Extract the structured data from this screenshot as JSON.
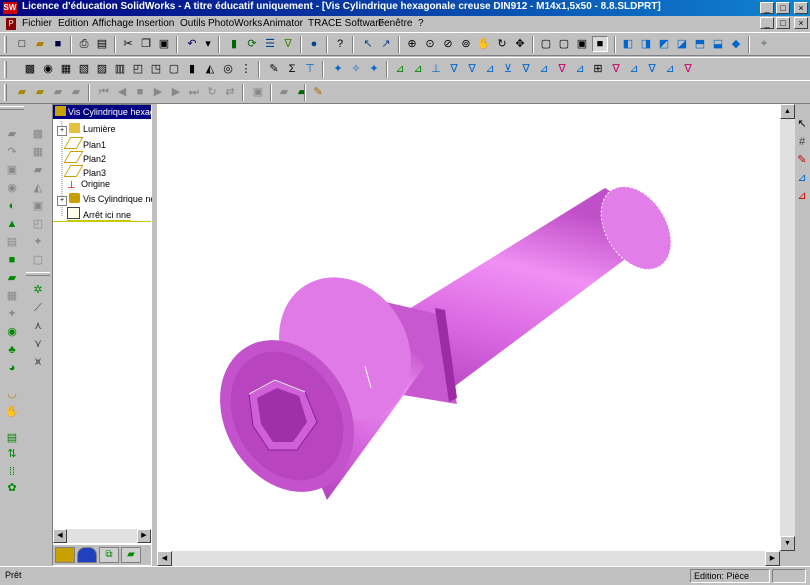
{
  "window": {
    "app_icon_text": "SW",
    "title": "Licence d'éducation SolidWorks - A titre éducatif uniquement - [Vis Cylindrique hexagonale creuse DIN912 - M14x1,5x50 - 8.8.SLDPRT]",
    "min": "_",
    "max": "□",
    "close": "×"
  },
  "menu": [
    "Fichier",
    "Edition",
    "Affichage",
    "Insertion",
    "Outils",
    "PhotoWorks",
    "Animator",
    "TRACE Software",
    "Fenêtre",
    "?"
  ],
  "feature_tree": {
    "root": "Vis Cylindrique hexagonale",
    "items": [
      "Lumière",
      "Plan1",
      "Plan2",
      "Plan3",
      "Origine",
      "Vis Cylindrique ne",
      "Arrêt ici nne"
    ]
  },
  "status": {
    "left": "Prêt",
    "right": "Edition: Pièce"
  },
  "colors": {
    "part": "#d060d8",
    "title_start": "#000080",
    "title_end": "#1084d0"
  }
}
